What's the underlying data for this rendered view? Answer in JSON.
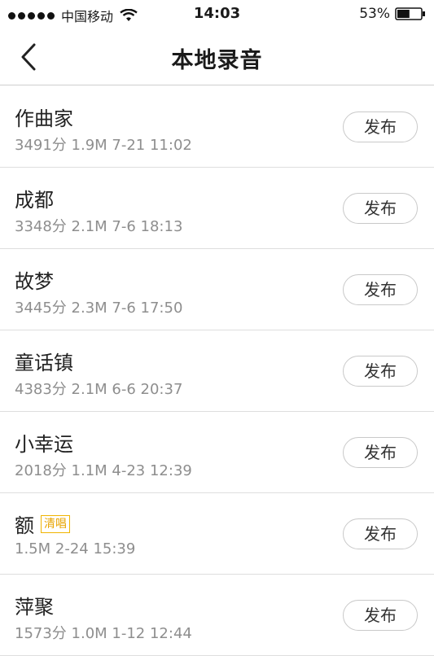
{
  "status_bar": {
    "carrier": "中国移动",
    "time": "14:03",
    "battery_percent": "53%",
    "battery_level": 0.53
  },
  "header": {
    "title": "本地录音",
    "back_icon": "chevron-left-icon"
  },
  "recordings": [
    {
      "name": "作曲家",
      "tag": "",
      "meta": "3491分 1.9M 7-21 11:02",
      "action": "发布"
    },
    {
      "name": "成都",
      "tag": "",
      "meta": "3348分 2.1M 7-6 18:13",
      "action": "发布"
    },
    {
      "name": "故梦",
      "tag": "",
      "meta": "3445分 2.3M 7-6 17:50",
      "action": "发布"
    },
    {
      "name": "童话镇",
      "tag": "",
      "meta": "4383分 2.1M 6-6 20:37",
      "action": "发布"
    },
    {
      "name": "小幸运",
      "tag": "",
      "meta": "2018分 1.1M 4-23 12:39",
      "action": "发布"
    },
    {
      "name": "额",
      "tag": "清唱",
      "meta": "1.5M 2-24 15:39",
      "action": "发布"
    },
    {
      "name": "萍聚",
      "tag": "",
      "meta": "1573分 1.0M 1-12 12:44",
      "action": "发布"
    }
  ],
  "colors": {
    "tag": "#e8a400",
    "meta_text": "#8e8e8e",
    "divider": "#dedede"
  }
}
